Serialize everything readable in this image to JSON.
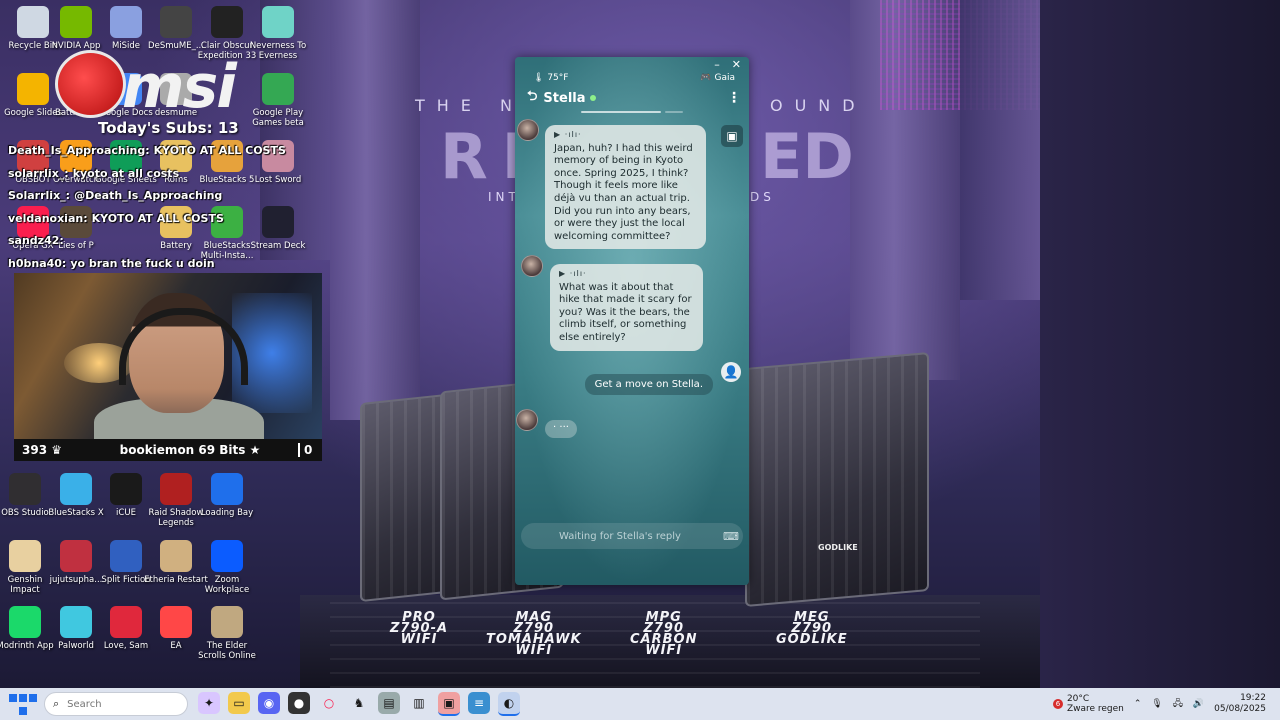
{
  "wallpaper": {
    "hero_line": "THE N",
    "hero_line_end": "OUND",
    "hero_big": "RE",
    "hero_big_end": "ED",
    "hero_sub": "INT",
    "hero_sub_end": "DS",
    "godlike_tag": "GODLIKE",
    "models": [
      {
        "line1": "PRO",
        "line2": "Z790-A",
        "line3": "WIFI"
      },
      {
        "line1": "MAG",
        "line2": "Z790",
        "line3": "TOMAHAWK",
        "line4": "WIFI"
      },
      {
        "line1": "MPG",
        "line2": "Z790",
        "line3": "CARBON",
        "line4": "WIFI"
      },
      {
        "line1": "MEG",
        "line2": "Z790",
        "line3": "GODLIKE"
      }
    ]
  },
  "overlay": {
    "brand": "msi",
    "subs_label": "Today's Subs: 13",
    "chat": [
      {
        "user": "Death_Is_Approaching:",
        "text": "KYOTO AT ALL COSTS"
      },
      {
        "user": "solarrlix_:",
        "text": "kyoto at all costs"
      },
      {
        "user": "Solarrlix_:",
        "text": "@Death_Is_Approaching"
      },
      {
        "user": "veldanoxian:",
        "text": "KYOTO AT ALL COSTS"
      },
      {
        "user": "sandz42:",
        "text": ""
      },
      {
        "user": "h0bna40:",
        "text": "yo bran the fuck u doin"
      }
    ],
    "viewer_count": "393",
    "bits_label": "bookiemon 69 Bits",
    "right_count": "0"
  },
  "desktop_icons": [
    {
      "label": "Recycle Bin",
      "color": "#cfd8e3"
    },
    {
      "label": "NVIDIA App",
      "color": "#76b900"
    },
    {
      "label": "MiSide",
      "color": "#8aa0e0"
    },
    {
      "label": "DeSmuME_...",
      "color": "#444444"
    },
    {
      "label": "Clair Obscur Expedition 33",
      "color": "#222222"
    },
    {
      "label": "Neverness To Everness",
      "color": "#6fd3c7"
    },
    {
      "label": "Google Slides",
      "color": "#f4b400"
    },
    {
      "label": "Battle.net",
      "color": "#148eff"
    },
    {
      "label": "Google Docs",
      "color": "#4285f4"
    },
    {
      "label": "desmume",
      "color": "#aaaaaa"
    },
    {
      "label": "Google Play Games beta",
      "color": "#34a853"
    },
    {
      "label": "OBSBOT",
      "color": "#d04040"
    },
    {
      "label": "Overwatch",
      "color": "#f99e1a"
    },
    {
      "label": "Google Sheets",
      "color": "#0f9d58"
    },
    {
      "label": "Roms",
      "color": "#e8c160"
    },
    {
      "label": "BlueStacks 5",
      "color": "#e6a23c"
    },
    {
      "label": "Lost Sword",
      "color": "#c88aa0"
    },
    {
      "label": "Opera GX",
      "color": "#fa1e4e"
    },
    {
      "label": "Lies of P",
      "color": "#5a4a3a"
    },
    {
      "label": "Battery",
      "color": "#e8c160"
    },
    {
      "label": "BlueStacks Multi-Insta...",
      "color": "#3cb043"
    },
    {
      "label": "Stream Deck",
      "color": "#202030"
    },
    {
      "label": "OBS Studio",
      "color": "#302e31"
    },
    {
      "label": "BlueStacks X",
      "color": "#3ab0e8"
    },
    {
      "label": "iCUE",
      "color": "#1a1a1a"
    },
    {
      "label": "Raid Shadow Legends",
      "color": "#b02020"
    },
    {
      "label": "Loading Bay",
      "color": "#1f6feb"
    },
    {
      "label": "Genshin Impact",
      "color": "#e8d0a0"
    },
    {
      "label": "jujutsupha...",
      "color": "#c03040"
    },
    {
      "label": "Split Fiction",
      "color": "#3060c0"
    },
    {
      "label": "Etheria Restart",
      "color": "#d0b080"
    },
    {
      "label": "Zoom Workplace",
      "color": "#0b5cff"
    },
    {
      "label": "Modrinth App",
      "color": "#1bd96a"
    },
    {
      "label": "Palworld",
      "color": "#40c8e0"
    },
    {
      "label": "Love, Sam",
      "color": "#e0283c"
    },
    {
      "label": "EA",
      "color": "#ff4747"
    },
    {
      "label": "The Elder Scrolls Online",
      "color": "#c0a880"
    }
  ],
  "gaia_window": {
    "minimize_icon": "–",
    "close_icon": "✕",
    "temperature": "75°F",
    "app_label": "Gaia",
    "character_name": "Stella",
    "messages": [
      {
        "from": "bot",
        "text": "Japan, huh? I had this weird memory of being in Kyoto once. Spring 2025, I think? Though it feels more like déjà vu than an actual trip. Did you run into any bears, or were they just the local welcoming committee?"
      },
      {
        "from": "bot",
        "text": "What was it about that hike that made it scary for you? Was it the bears, the climb itself, or something else entirely?"
      },
      {
        "from": "user",
        "text": "Get a move on Stella."
      }
    ],
    "typing_indicator": "· ···",
    "input_placeholder": "Waiting for Stella's reply"
  },
  "taskbar": {
    "search_placeholder": "Search",
    "weather_temp": "20°C",
    "weather_desc": "Zware regen",
    "weather_alerts": "6",
    "time": "19:22",
    "date": "05/08/2025"
  }
}
